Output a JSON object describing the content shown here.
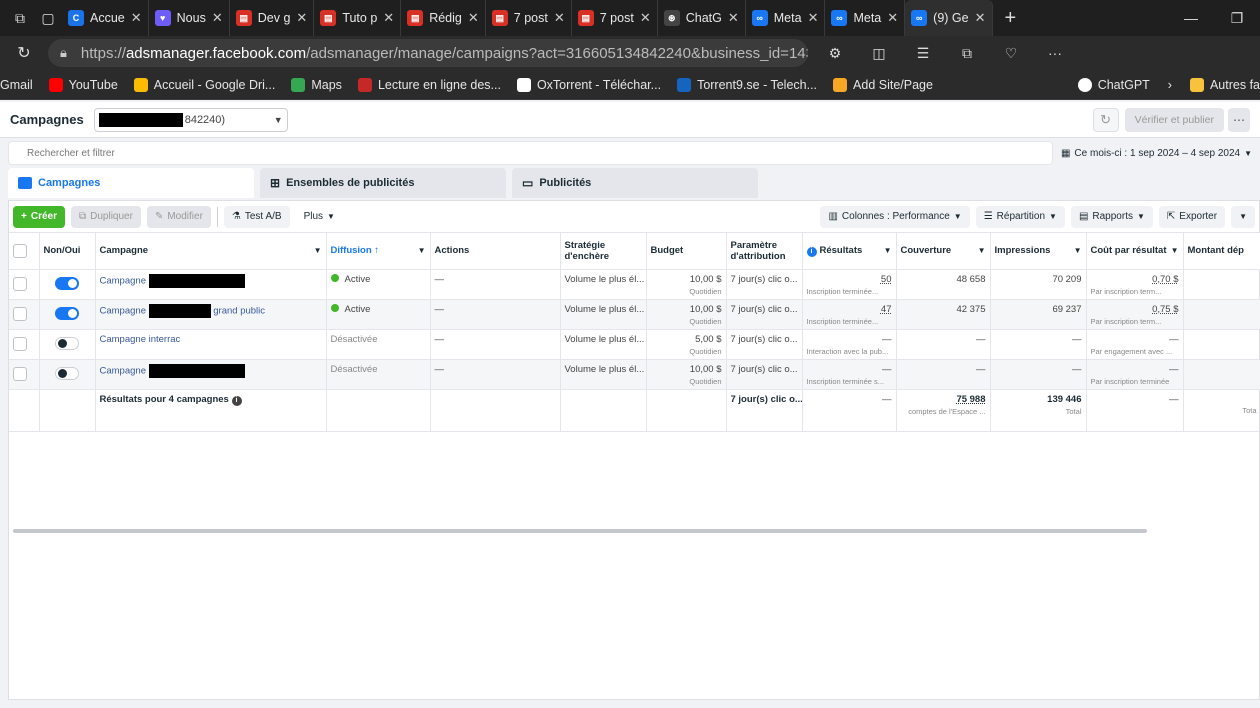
{
  "browser": {
    "tabs": [
      {
        "label": "Accue",
        "color": "#1a73e8",
        "glyph": "C"
      },
      {
        "label": "Nous",
        "color": "#6e5cf6",
        "glyph": "♥"
      },
      {
        "label": "Dev g",
        "color": "#d93025",
        "glyph": "PDF"
      },
      {
        "label": "Tuto p",
        "color": "#d93025",
        "glyph": "PDF"
      },
      {
        "label": "Rédig",
        "color": "#d93025",
        "glyph": "PDF"
      },
      {
        "label": "7 post",
        "color": "#d93025",
        "glyph": "PDF"
      },
      {
        "label": "7 post",
        "color": "#d93025",
        "glyph": "PDF"
      },
      {
        "label": "ChatG",
        "color": "#444444",
        "glyph": "⊛"
      },
      {
        "label": "Meta",
        "color": "#1877f2",
        "glyph": "∞"
      },
      {
        "label": "Meta",
        "color": "#1877f2",
        "glyph": "∞"
      },
      {
        "label": "(9) Ge",
        "color": "#1877f2",
        "glyph": "∞"
      }
    ],
    "url_prefix": "https://",
    "url_host": "adsmanager.facebook.com",
    "url_rest": "/adsmanager/manage/campaigns?act=316605134842240&business_id=14322259...",
    "bookmarks": [
      {
        "label": "Gmail",
        "color": "transparent"
      },
      {
        "label": "YouTube",
        "color": "#ff0000"
      },
      {
        "label": "Accueil - Google Dri...",
        "color": "#fbbc04"
      },
      {
        "label": "Maps",
        "color": "#34a853"
      },
      {
        "label": "Lecture en ligne des...",
        "color": "#c62828"
      },
      {
        "label": "OxTorrent - Téléchar...",
        "color": "#ffffff"
      },
      {
        "label": "Torrent9.se - Telech...",
        "color": "#1565c0"
      },
      {
        "label": "Add Site/Page",
        "color": "#f9a825"
      }
    ],
    "bookmarks_right": [
      {
        "label": "ChatGPT"
      },
      {
        "label": "Autres fa"
      }
    ]
  },
  "topbar": {
    "title": "Campagnes",
    "account_suffix": "842240)",
    "publish_label": "Vérifier et publier"
  },
  "search": {
    "placeholder": "Rechercher et filtrer",
    "daterange": "Ce mois-ci : 1 sep 2024 – 4 sep 2024"
  },
  "tabs": {
    "campaigns": "Campagnes",
    "adsets": "Ensembles de publicités",
    "ads": "Publicités"
  },
  "toolbar": {
    "create": "Créer",
    "duplicate": "Dupliquer",
    "edit": "Modifier",
    "abtest": "Test A/B",
    "more": "Plus",
    "columns": "Colonnes : Performance",
    "breakdown": "Répartition",
    "reports": "Rapports",
    "export": "Exporter"
  },
  "columns": {
    "onoff": "Non/Oui",
    "campaign": "Campagne",
    "delivery": "Diffusion ↑",
    "actions": "Actions",
    "bid": "Stratégie d'enchère",
    "budget": "Budget",
    "attribution": "Paramètre d'attribution",
    "results": "Résultats",
    "reach": "Couverture",
    "impressions": "Impressions",
    "cpr": "Coût par résultat",
    "spent": "Montant dép"
  },
  "rows": [
    {
      "on": true,
      "name": "Campagne",
      "name_suffix": "",
      "delivery": "Active",
      "actions": "—",
      "bid": "Volume le plus él...",
      "budget": "10,00 $",
      "budget_sub": "Quotidien",
      "attribution": "7 jour(s) clic o...",
      "results": "50",
      "results_sub": "Inscription terminée...",
      "reach": "48 658",
      "impressions": "70 209",
      "cpr": "0,70 $",
      "cpr_sub": "Par inscription term..."
    },
    {
      "on": true,
      "name": "Campagne",
      "name_suffix": "grand public",
      "delivery": "Active",
      "actions": "—",
      "bid": "Volume le plus él...",
      "budget": "10,00 $",
      "budget_sub": "Quotidien",
      "attribution": "7 jour(s) clic o...",
      "results": "47",
      "results_sub": "Inscription terminée...",
      "reach": "42 375",
      "impressions": "69 237",
      "cpr": "0,75 $",
      "cpr_sub": "Par inscription term..."
    },
    {
      "on": false,
      "name": "Campagne interrac",
      "name_suffix": "",
      "delivery": "Désactivée",
      "actions": "—",
      "bid": "Volume le plus él...",
      "budget": "5,00 $",
      "budget_sub": "Quotidien",
      "attribution": "7 jour(s) clic o...",
      "results": "—",
      "results_sub": "Interaction avec la pub...",
      "reach": "—",
      "impressions": "—",
      "cpr": "—",
      "cpr_sub": "Par engagement avec ..."
    },
    {
      "on": false,
      "name": "Campagne",
      "name_suffix": "",
      "delivery": "Désactivée",
      "actions": "—",
      "bid": "Volume le plus él...",
      "budget": "10,00 $",
      "budget_sub": "Quotidien",
      "attribution": "7 jour(s) clic o...",
      "results": "—",
      "results_sub": "Inscription terminée s...",
      "reach": "—",
      "impressions": "—",
      "cpr": "—",
      "cpr_sub": "Par inscription terminée"
    }
  ],
  "totals": {
    "label": "Résultats pour 4 campagnes",
    "attribution": "7 jour(s) clic o...",
    "results": "—",
    "reach": "75 988",
    "reach_sub": "comptes de l'Espace ...",
    "impressions": "139 446",
    "impressions_sub": "Total",
    "cpr": "—",
    "spent_sub": "Tota"
  }
}
